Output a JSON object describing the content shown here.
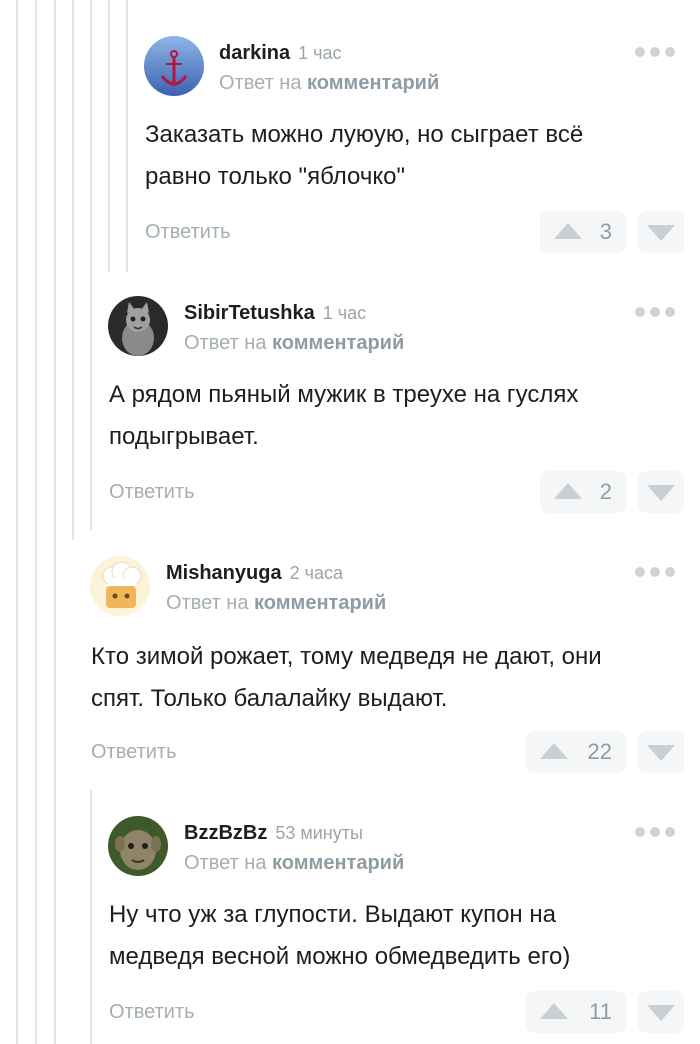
{
  "reply_prefix": "Ответ на",
  "reply_link": "комментарий",
  "reply_label": "Ответить",
  "comments": [
    {
      "author": "darkina",
      "time": "1 час",
      "lines": [
        "Заказать можно луюую, но сыграет всё",
        "равно только \"яблочко\""
      ],
      "votes": "3",
      "avatar_icon": "anchor-icon"
    },
    {
      "author": "SibirTetushka",
      "time": "1 час",
      "lines": [
        "А рядом пьяный мужик в треухе на гуслях",
        "подыгрывает."
      ],
      "votes": "2",
      "avatar_icon": "cat-photo-icon"
    },
    {
      "author": "Mishanyuga",
      "time": "2 часа",
      "lines": [
        "Кто зимой рожает, тому медведя не дают, они",
        "спят. Только балалайку выдают."
      ],
      "votes": "22",
      "avatar_icon": "chef-icon"
    },
    {
      "author": "BzzBzBz",
      "time": "53 минуты",
      "lines": [
        "Ну что уж за глупости. Выдают купон на",
        "медведя весной можно обмедведить его)"
      ],
      "votes": "11",
      "avatar_icon": "creature-photo-icon"
    }
  ],
  "colors": {
    "author": "#1e1e1e",
    "muted": "#a4aeb3",
    "thread_line": "#e3e6e8",
    "vote_bg": "#f4f6f7"
  }
}
